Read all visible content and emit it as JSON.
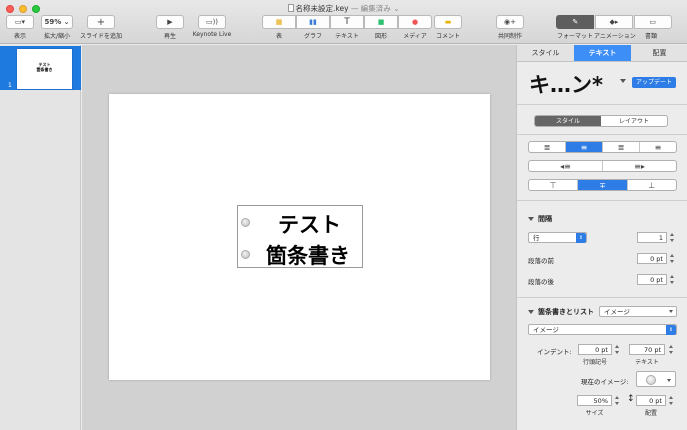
{
  "window": {
    "doc_name": "名称未設定.key",
    "doc_status": "— 編集済み ⌄"
  },
  "toolbar": {
    "view_label": "表示",
    "zoom_value": "59%",
    "zoom_label": "拡大/縮小",
    "add_slide_label": "スライドを追加",
    "play_label": "再生",
    "keynote_live_label": "Keynote Live",
    "table_label": "表",
    "chart_label": "グラフ",
    "text_label": "テキスト",
    "shape_label": "図形",
    "media_label": "メディア",
    "comment_label": "コメント",
    "collaborate_label": "共同制作",
    "format_label": "フォーマット",
    "animate_label": "アニメーション",
    "document_label": "書類"
  },
  "navigator": {
    "slide_number": "1",
    "thumb_line1": "テスト",
    "thumb_line2": "箇条書き"
  },
  "slide": {
    "line1": "テスト",
    "line2": "箇条書き"
  },
  "inspector": {
    "tabs": [
      "スタイル",
      "テキスト",
      "配置"
    ],
    "paragraph_style": "キ…ン*",
    "update_button": "アップデート",
    "subtabs": [
      "スタイル",
      "レイアウト"
    ],
    "spacing_title": "間隔",
    "spacing_unit": "行",
    "spacing_value": "1",
    "before_label": "段落の前",
    "before_value": "0 pt",
    "after_label": "段落の後",
    "after_value": "0 pt",
    "bullets_title": "箇条書きとリスト",
    "bullets_type": "イメージ",
    "bullets_style": "イメージ",
    "indent_label": "インデント:",
    "bullet_indent_value": "0 pt",
    "bullet_indent_caption": "行頭記号",
    "text_indent_value": "70 pt",
    "text_indent_caption": "テキスト",
    "current_image_label": "現在のイメージ:",
    "size_value": "50%",
    "size_caption": "サイズ",
    "align_value": "0 pt",
    "align_caption": "配置"
  },
  "colors": {
    "accent": "#2e7ce6",
    "tab_active": "#3d8ef7"
  }
}
